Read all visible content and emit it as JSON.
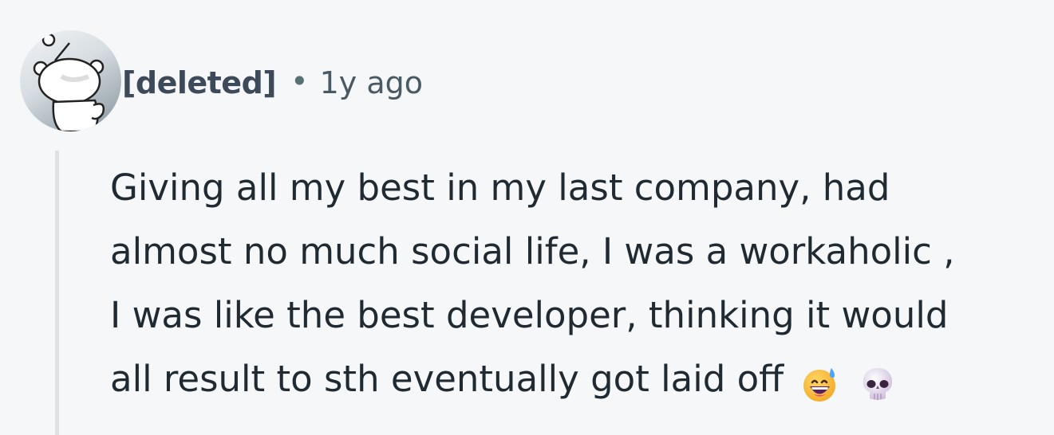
{
  "comment": {
    "author": "[deleted]",
    "separator": "•",
    "age": "1y ago",
    "avatar_icon": "snoo-avatar-icon",
    "body_lines": [
      "Giving all my best in my last company, had",
      "almost no much social life, I was a workaholic ,",
      "I was like the best developer, thinking it would",
      "all result to sth eventually got laid off"
    ],
    "emojis": [
      "grinning-face-with-sweat-icon",
      "skull-icon"
    ]
  },
  "colors": {
    "background": "#f6f7f9",
    "author": "#3c4a5a",
    "meta": "#4a5a65",
    "body_text": "#1f2a33",
    "thread_line": "#dde1e5"
  }
}
